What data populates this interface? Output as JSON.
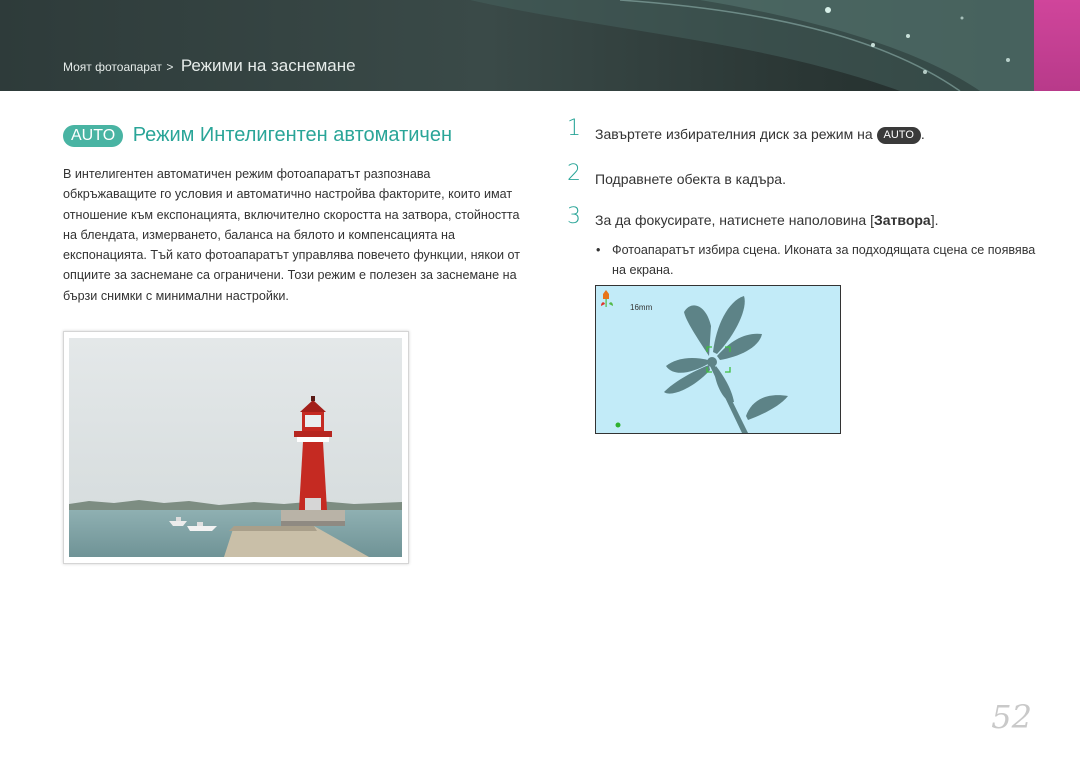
{
  "header": {
    "breadcrumb_parent": "Моят фотоапарат",
    "breadcrumb_separator": ">",
    "breadcrumb_current": "Режими на заснемане",
    "accent_color": "#d0459b"
  },
  "section": {
    "badge": "AUTO",
    "title": "Режим Интелигентен автоматичен",
    "accent_color": "#2aa598"
  },
  "intro_text": "В интелигентен автоматичен режим фотоапаратът разпознава обкръжаващите го условия и автоматично настройва факторите, които имат отношение към експонацията, включително скоростта на затвора, стойността на блендата, измерването, баланса на бялото и компенсацията на експонацията. Тъй като фотоапаратът управлява повечето функции, някои от опциите за заснемане са ограничени. Този режим е полезен за заснемане на бързи снимки с минимални настройки.",
  "steps": [
    {
      "number": "1",
      "text": "Завъртете избирателния диск за режим на",
      "badge": "AUTO",
      "suffix": "."
    },
    {
      "number": "2",
      "text": "Подравнете обекта в кадъра."
    },
    {
      "number": "3",
      "text_before": "За да фокусирате, натиснете наполовина [",
      "bold": "Затвора",
      "text_after": "]."
    }
  ],
  "bullet": {
    "symbol": "•",
    "text": "Фотоапаратът избира сцена. Иконата за подходящата сцена се появява на екрана."
  },
  "lcd": {
    "focal_length": "16mm",
    "scene_icon": "flower-scene-icon"
  },
  "page_number": "52"
}
